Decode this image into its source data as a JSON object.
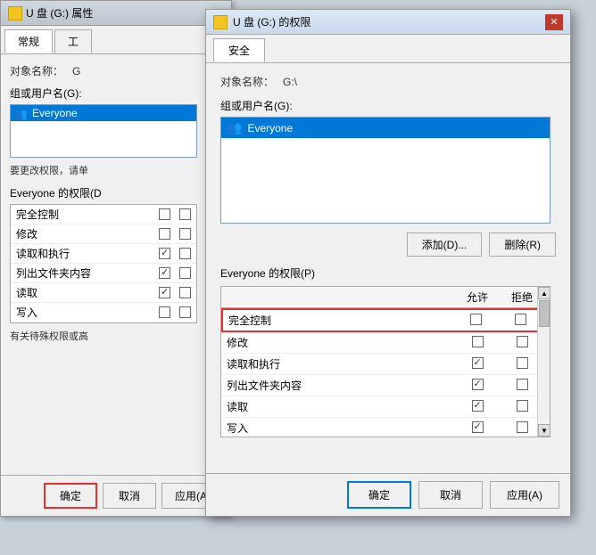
{
  "background_window": {
    "title": "U 盘 (G:) 属性",
    "tabs": [
      "常规",
      "工"
    ],
    "object_label": "对象名称：",
    "object_value": "G",
    "group_label": "组或用户名(G):",
    "user": "Everyone",
    "notice": "要更改权限，请单",
    "perm_label": "Everyone 的权限(D",
    "permissions": [
      {
        "name": "完全控制",
        "allow": false,
        "deny": false
      },
      {
        "name": "修改",
        "allow": false,
        "deny": false
      },
      {
        "name": "读取和执行",
        "allow": true,
        "deny": false
      },
      {
        "name": "列出文件夹内容",
        "allow": true,
        "deny": false
      },
      {
        "name": "读取",
        "allow": true,
        "deny": false
      },
      {
        "name": "写入",
        "allow": false,
        "deny": false
      }
    ],
    "notice2": "有关待殊权限或高",
    "buttons": {
      "ok": "确定",
      "cancel": "取消",
      "apply": "应用(A)"
    }
  },
  "main_dialog": {
    "title": "U 盘 (G:) 的权限",
    "tab": "安全",
    "object_label": "对象名称：",
    "object_value": "G:\\",
    "group_label": "组或用户名(G):",
    "user": "Everyone",
    "btn_add": "添加(D)...",
    "btn_remove": "删除(R)",
    "perm_section_label": "Everyone 的权限(P)",
    "perm_col_allow": "允许",
    "perm_col_deny": "拒绝",
    "permissions": [
      {
        "name": "完全控制",
        "allow": false,
        "deny": false,
        "highlighted": true
      },
      {
        "name": "修改",
        "allow": false,
        "deny": false,
        "highlighted": false
      },
      {
        "name": "读取和执行",
        "allow": true,
        "deny": false,
        "highlighted": false
      },
      {
        "name": "列出文件夹内容",
        "allow": true,
        "deny": false,
        "highlighted": false
      },
      {
        "name": "读取",
        "allow": true,
        "deny": false,
        "highlighted": false
      },
      {
        "name": "写入",
        "allow": true,
        "deny": false,
        "highlighted": false
      }
    ],
    "buttons": {
      "ok": "确定",
      "cancel": "取消",
      "apply": "应用(A)"
    }
  },
  "icons": {
    "user_icon": "👥",
    "drive_icon": "💾",
    "close_icon": "✕",
    "up_arrow": "▲",
    "down_arrow": "▼"
  }
}
